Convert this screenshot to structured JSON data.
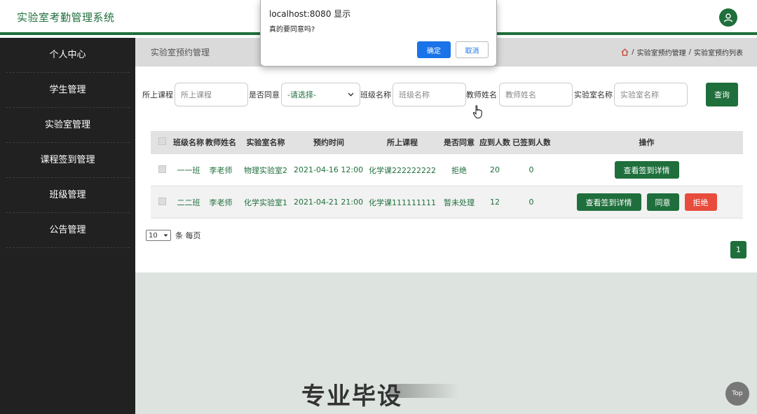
{
  "app": {
    "title": "实验室考勤管理系统"
  },
  "sidebar": {
    "items": [
      {
        "label": "个人中心"
      },
      {
        "label": "学生管理"
      },
      {
        "label": "实验室管理"
      },
      {
        "label": "课程签到管理"
      },
      {
        "label": "班级管理"
      },
      {
        "label": "公告管理"
      }
    ]
  },
  "page": {
    "heading": "实验室预约管理",
    "breadcrumb": [
      "实验室预约管理",
      "实验室预约列表"
    ],
    "breadcrumb_sep": "/"
  },
  "search": {
    "course_label": "所上课程",
    "course_placeholder": "所上课程",
    "agree_label": "是否同意",
    "agree_selected": "-请选择-",
    "class_label": "班级名称",
    "class_placeholder": "班级名称",
    "teacher_label": "教师姓名",
    "teacher_placeholder": "教师姓名",
    "lab_label": "实验室名称",
    "lab_placeholder": "实验室名称",
    "button": "查询"
  },
  "table": {
    "headers": [
      "班级名称",
      "教师姓名",
      "实验室名称",
      "预约时间",
      "所上课程",
      "是否同意",
      "应到人数",
      "已签到人数",
      "操作"
    ],
    "rows": [
      {
        "class_name": "一一班",
        "teacher": "李老师",
        "lab": "物理实验室2",
        "time": "2021-04-16 12:00:00",
        "course": "化学课222222222",
        "agree": "拒绝",
        "expected": "20",
        "signed": "0"
      },
      {
        "class_name": "二二班",
        "teacher": "李老师",
        "lab": "化学实验室1",
        "time": "2021-04-21 21:00:00",
        "course": "化学课111111111",
        "agree": "暂未处理",
        "expected": "12",
        "signed": "0"
      }
    ],
    "actions": {
      "view": "查看签到详情",
      "approve": "同意",
      "reject": "拒绝"
    }
  },
  "pager": {
    "page_size": "10",
    "suffix": "条 每页",
    "current_page": "1"
  },
  "dialog": {
    "title": "localhost:8080 显示",
    "message": "真的要同意吗?",
    "ok": "确定",
    "cancel": "取消"
  },
  "watermark": "专业毕设",
  "back_to_top": "Top",
  "colors": {
    "primary": "#1f6f3c",
    "danger": "#e74c3c",
    "sidebar": "#212121",
    "dialog_ok": "#1a73e8"
  }
}
